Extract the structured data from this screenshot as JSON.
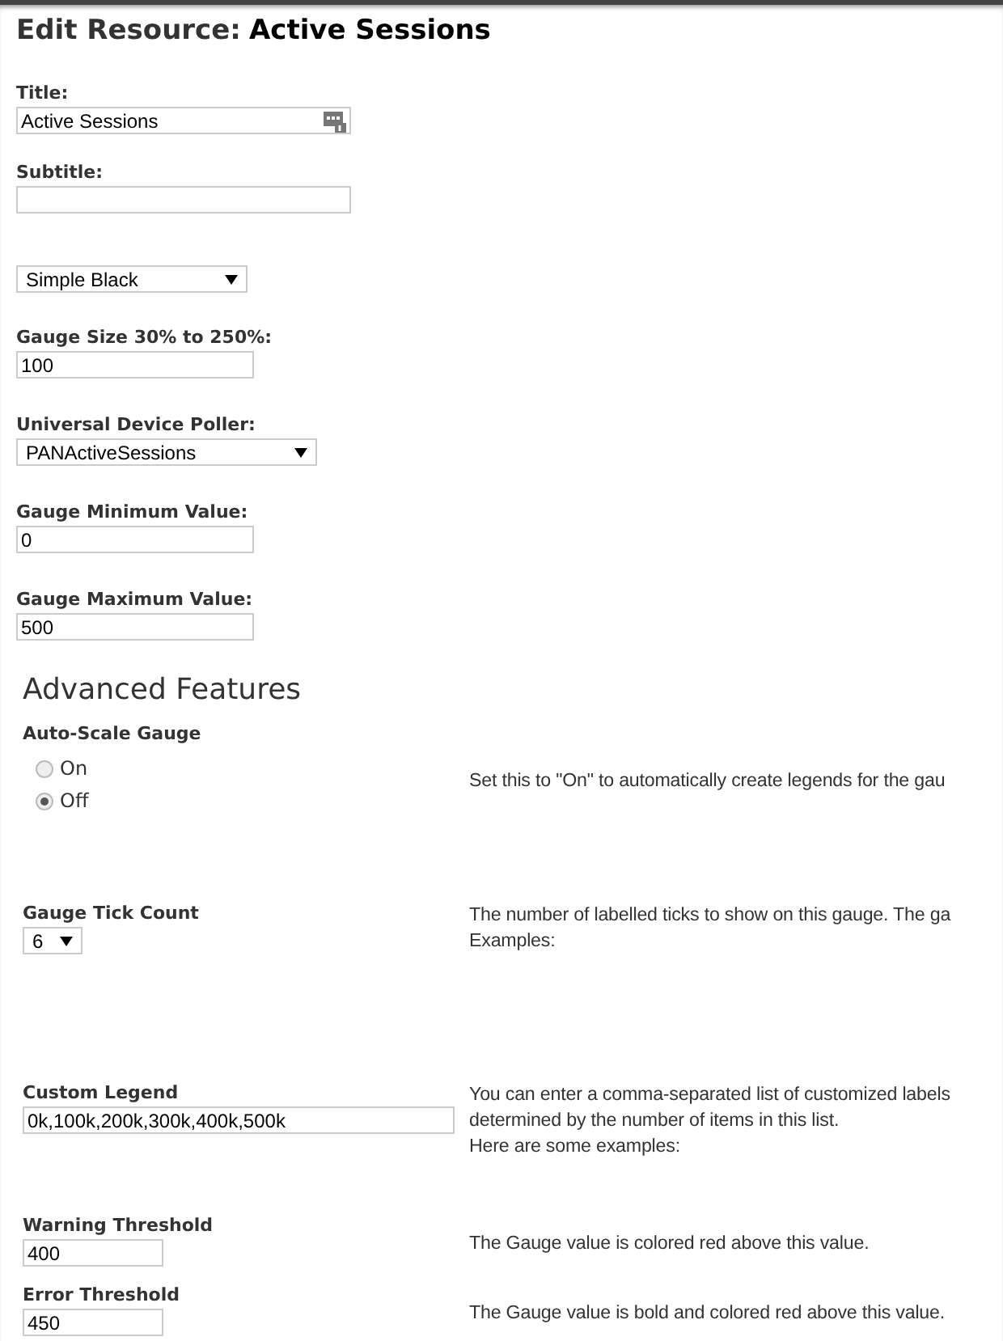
{
  "heading": {
    "prefix": "Edit Resource:",
    "name": "Active Sessions"
  },
  "fields": [
    {
      "kind": "text",
      "label": "Title:",
      "value": "Active Sessions",
      "has_icon": true
    },
    {
      "kind": "text",
      "label": "Subtitle:"
    },
    {
      "kind": "select",
      "value": "Simple Black"
    },
    {
      "kind": "text",
      "label": "Gauge Size 30% to 250%:",
      "value": "100"
    },
    {
      "kind": "select",
      "label": "Universal Device Poller:",
      "value": "PANActiveSessions"
    },
    {
      "kind": "text",
      "label": "Gauge Minimum Value:",
      "value": "0"
    },
    {
      "kind": "text",
      "label": "Gauge Maximum Value:",
      "value": "500"
    }
  ],
  "advanced": {
    "title": "Advanced Features",
    "rows": [
      {
        "kind": "radio",
        "label": "Auto-Scale Gauge",
        "options": [
          {
            "label": "On",
            "selected": false
          },
          {
            "label": "Off",
            "selected": true
          }
        ],
        "help": [
          "Set this to \"On\" to automatically create legends for the gau"
        ]
      },
      {
        "kind": "select",
        "label": "Gauge Tick Count",
        "value": "6",
        "help": [
          "The number of labelled ticks to show on this gauge. The ga",
          "Examples:"
        ]
      },
      {
        "kind": "text",
        "label": "Custom Legend",
        "value": "0k,100k,200k,300k,400k,500k",
        "help": [
          "You can enter a comma-separated list of customized labels",
          "determined by the number of items in this list.",
          "Here are some examples:"
        ]
      },
      {
        "kind": "text",
        "label": "Warning Threshold",
        "value": "400",
        "help": [
          "The Gauge value is colored red above this value."
        ]
      },
      {
        "kind": "text",
        "label": "Error Threshold",
        "value": "450",
        "help": [
          "The Gauge value is bold and colored red above this value."
        ]
      }
    ]
  }
}
